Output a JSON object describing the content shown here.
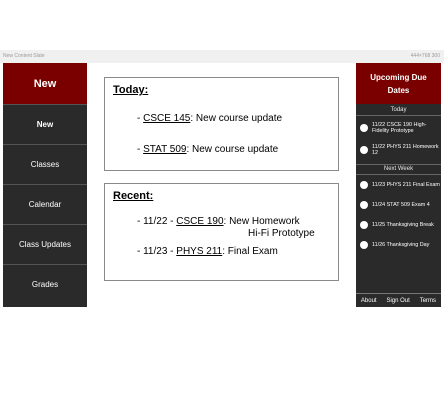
{
  "topbar": {
    "left": "New Content Slate",
    "right": "444×768 300"
  },
  "nav": {
    "header": "New",
    "items": [
      "New",
      "Classes",
      "Calendar",
      "Class Updates",
      "Grades"
    ]
  },
  "today": {
    "title": "Today:",
    "items": [
      {
        "course": "CSCE 145",
        "text": ": New course update"
      },
      {
        "course": "STAT 509",
        "text": ": New course update"
      }
    ]
  },
  "recent": {
    "title": "Recent:",
    "items": [
      {
        "prefix": "- 11/22 - ",
        "course": "CSCE 190",
        "text": ": New Homework",
        "text2": "Hi-Fi Prototype"
      },
      {
        "prefix": "- 11/23 - ",
        "course": "PHYS 211",
        "text": ": Final Exam"
      }
    ]
  },
  "due": {
    "header": "Upcoming Due Dates",
    "today_label": "Today",
    "today_items": [
      "11/22 CSCE 190 High-Fidelity Prototype",
      "11/22 PHYS 211 Homework 12"
    ],
    "next_week_label": "Next Week",
    "next_week_items": [
      "11/23 PHYS 211 Final Exam",
      "11/24 STAT 509 Exam 4",
      "11/25 Thanksgiving Break",
      "11/26 Thanksgiving Day"
    ],
    "footer": [
      "About",
      "Sign Out",
      "Terms"
    ]
  }
}
